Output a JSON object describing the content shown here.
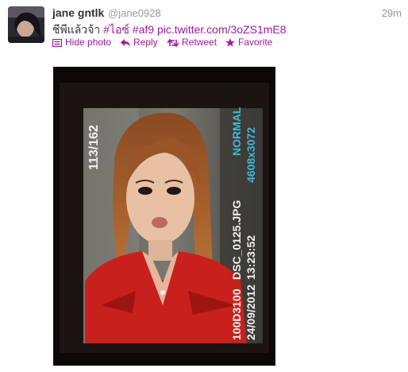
{
  "user": {
    "fullname": "jane gntlk",
    "username": "@jane0928"
  },
  "tweet": {
    "time": "29m",
    "text_plain": "ชีพีแล้วจ้า ",
    "hashtag_1": "#ไอซ์",
    "hashtag_2": "#af9",
    "link": "pic.twitter.com/3oZS1mE8"
  },
  "actions": {
    "hide_photo": "Hide photo",
    "reply": "Reply",
    "retweet": "Retweet",
    "favorite": "Favorite"
  },
  "camera_overlay": {
    "frame_count": "113/162",
    "quality": "NORMAL",
    "resolution": "4608x3072",
    "filename": "DSC_0125.JPG",
    "time": "13:23:52",
    "folder": "100D3100",
    "date": "24/09/2012"
  },
  "colors": {
    "link": "#a3189f",
    "name": "#333333",
    "muted": "#999999",
    "jacket": "#c8201c",
    "overlay_text": "#f2f2f2"
  }
}
